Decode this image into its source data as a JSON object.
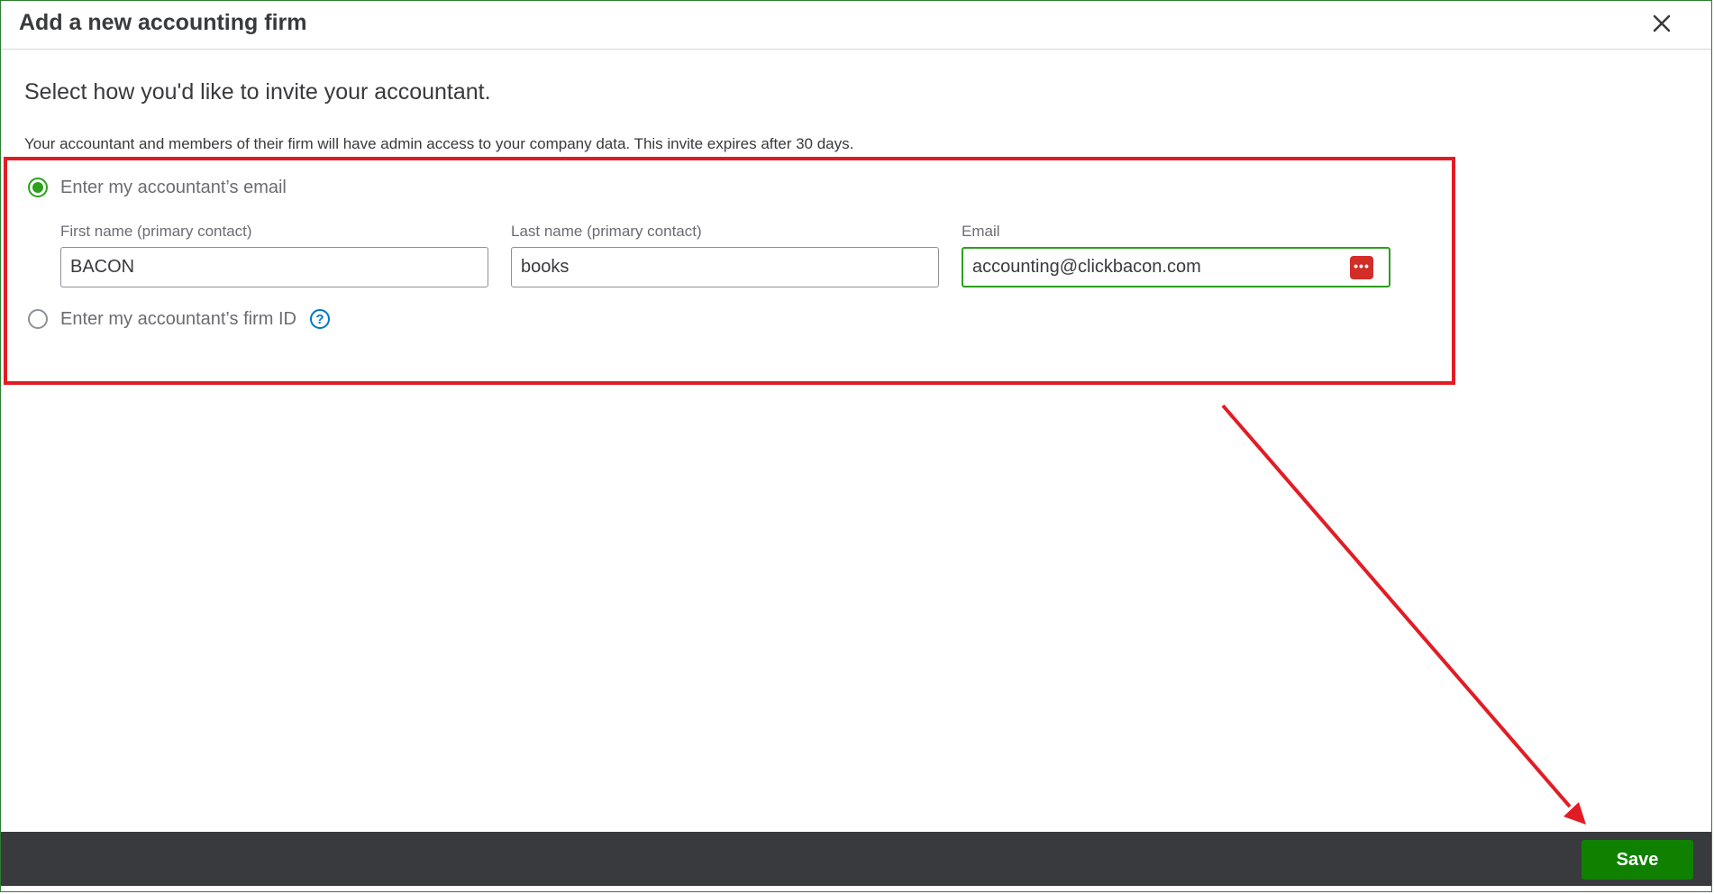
{
  "dialog": {
    "title": "Add a new accounting firm",
    "subtitle": "Select how you'd like to invite your accountant.",
    "description": "Your accountant and members of their firm will have admin access to your company data. This invite expires after 30 days."
  },
  "options": {
    "email_option_label": "Enter my accountant’s email",
    "firm_id_option_label": "Enter my accountant’s firm ID",
    "selected": "email"
  },
  "fields": {
    "first_name_label": "First name (primary contact)",
    "first_name_value": "BACON",
    "last_name_label": "Last name (primary contact)",
    "last_name_value": "books",
    "email_label": "Email",
    "email_value": "accounting@clickbacon.com"
  },
  "footer": {
    "save_label": "Save"
  },
  "icons": {
    "close": "close-icon",
    "password_manager": "password-manager-icon",
    "help": "help-icon"
  },
  "colors": {
    "accent_green": "#2ca01c",
    "save_green": "#108000",
    "annotation_red": "#e21c25",
    "footer_bg": "#393a3d",
    "help_blue": "#0077c5"
  }
}
